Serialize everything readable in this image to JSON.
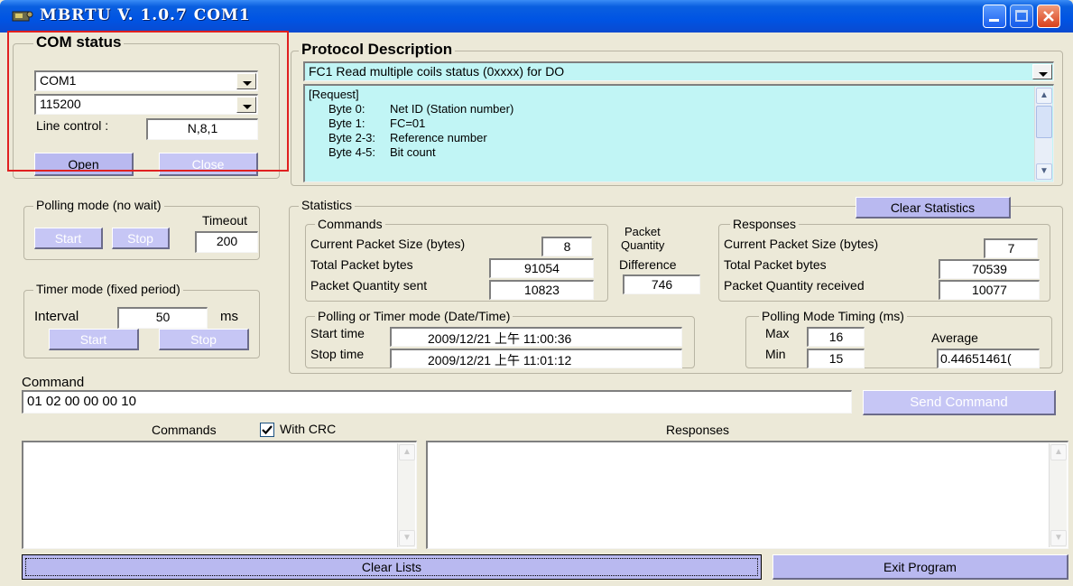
{
  "window": {
    "title": "MBRTU V. 1.0.7 COM1",
    "icon": "app-icon",
    "controls": [
      "minimize-icon",
      "maximize-icon",
      "close-icon"
    ]
  },
  "com_status": {
    "legend": "COM status",
    "port": "COM1",
    "baud": "115200",
    "line_control_label": "Line control :",
    "line_control_value": "N,8,1",
    "open_label": "Open",
    "close_label": "Close",
    "highlight_color": "#e02020"
  },
  "protocol": {
    "legend": "Protocol Description",
    "selected": "FC1  Read multiple coils status (0xxxx)  for DO",
    "description": [
      [
        "[Request]",
        ""
      ],
      [
        "Byte 0:",
        "Net ID (Station number)"
      ],
      [
        "Byte 1:",
        "FC=01"
      ],
      [
        "Byte 2-3:",
        "Reference number"
      ],
      [
        "Byte 4-5:",
        "Bit count"
      ]
    ]
  },
  "polling": {
    "legend": "Polling mode (no wait)",
    "timeout_label": "Timeout",
    "timeout_value": "200",
    "start_label": "Start",
    "stop_label": "Stop"
  },
  "timer": {
    "legend": "Timer mode (fixed period)",
    "interval_label": "Interval",
    "interval_value": "50",
    "unit": "ms",
    "start_label": "Start",
    "stop_label": "Stop"
  },
  "statistics": {
    "legend": "Statistics",
    "clear_label": "Clear Statistics",
    "commands": {
      "legend": "Commands",
      "size_label": "Current Packet Size (bytes)",
      "size_value": "8",
      "total_label": "Total Packet bytes",
      "total_value": "91054",
      "qty_label": "Packet Quantity sent",
      "qty_value": "10823"
    },
    "difference": {
      "label_line1": "Packet",
      "label_line2": "Quantity",
      "label_line3": "Difference",
      "value": "746"
    },
    "responses": {
      "legend": "Responses",
      "size_label": "Current Packet Size (bytes)",
      "size_value": "7",
      "total_label": "Total Packet bytes",
      "total_value": "70539",
      "qty_label": "Packet Quantity received",
      "qty_value": "10077"
    },
    "datetime": {
      "legend": "Polling  or Timer mode  (Date/Time)",
      "start_label": "Start time",
      "start_value": "2009/12/21 上午 11:00:36",
      "stop_label": "Stop time",
      "stop_value": "2009/12/21 上午 11:01:12"
    },
    "timing": {
      "legend": "Polling Mode Timing (ms)",
      "max_label": "Max",
      "max_value": "16",
      "min_label": "Min",
      "min_value": "15",
      "avg_label": "Average",
      "avg_value": "0.44651461("
    }
  },
  "command": {
    "label": "Command",
    "value": "01 02 00 00 00 10",
    "send_label": "Send Command"
  },
  "lists": {
    "commands_label": "Commands",
    "crc_label": "With CRC",
    "crc_checked": true,
    "responses_label": "Responses"
  },
  "bottom": {
    "clear_lists_label": "Clear Lists",
    "exit_label": "Exit Program"
  }
}
